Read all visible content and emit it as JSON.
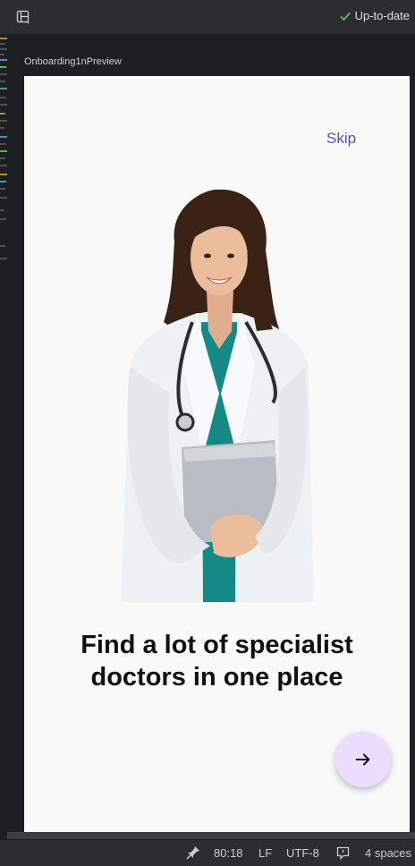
{
  "toolbar": {
    "layout_icon": "layout-icon",
    "status_text": "Up-to-date",
    "status_icon": "check-icon",
    "status_color": "#5fb865"
  },
  "preview": {
    "label": "Onboarding1nPreview"
  },
  "screen": {
    "skip_label": "Skip",
    "image": "doctor-illustration",
    "headline_line1": "Find a lot of specialist",
    "headline_line2": "doctors in one place",
    "next_button_icon": "arrow-right-icon",
    "accent_color": "#5e4ea4",
    "fab_color": "#eaddff"
  },
  "status_bar": {
    "cursor_position": "80:18",
    "line_ending": "LF",
    "encoding": "UTF-8",
    "indent": "4 spaces"
  }
}
